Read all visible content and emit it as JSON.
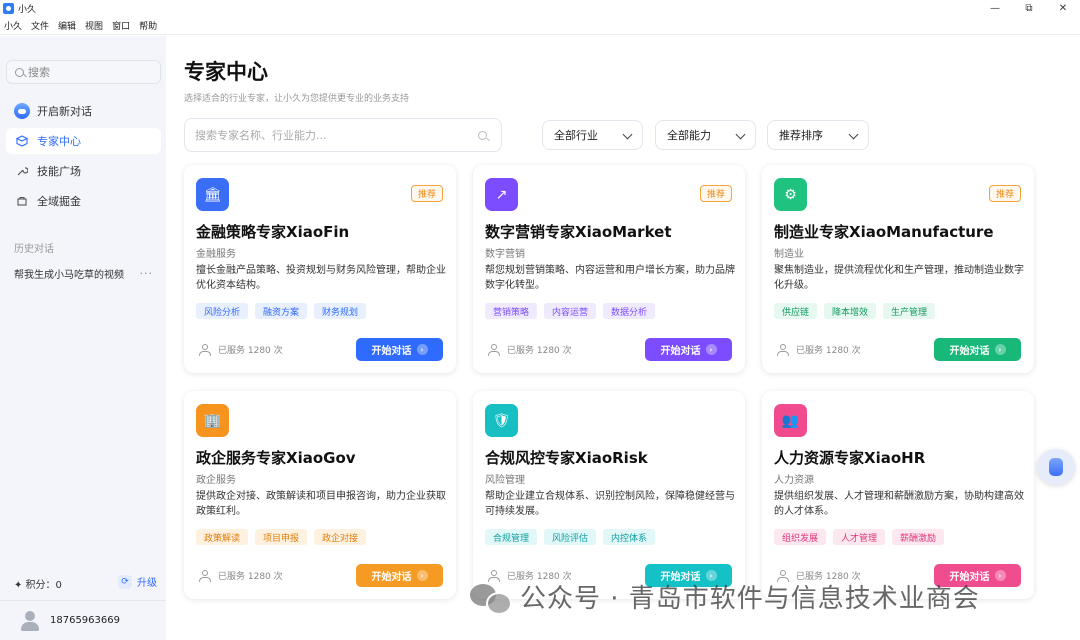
{
  "window": {
    "title": "小久",
    "controls": {
      "minimize": "—",
      "maximize": "⧉",
      "close": "✕"
    }
  },
  "menu": [
    "小久",
    "文件",
    "编辑",
    "视图",
    "窗口",
    "帮助"
  ],
  "sidebar": {
    "search_label": "搜索",
    "nav": [
      {
        "label": "开启新对话",
        "icon": "robot-icon"
      },
      {
        "label": "专家中心",
        "icon": "cube-icon"
      },
      {
        "label": "技能广场",
        "icon": "wrench-icon"
      },
      {
        "label": "全域掘金",
        "icon": "box-icon"
      }
    ],
    "history_title": "历史对话",
    "history": [
      {
        "label": "帮我生成小马吃草的视频",
        "more": "···"
      }
    ],
    "points_label": "✦ 积分：0",
    "upgrade_label": "升级",
    "user_phone": "18765963669"
  },
  "main": {
    "title": "专家中心",
    "subtitle": "选择适合的行业专家，让小久为您提供更专业的业务支持",
    "search_placeholder": "搜索专家名称、行业能力...",
    "filters": [
      "全部行业",
      "全部能力",
      "推荐排序"
    ]
  },
  "cards": [
    {
      "title": "金融策略专家XiaoFin",
      "category": "金融服务",
      "desc": "擅长金融产品策略、投资规划与财务风险管理，帮助企业优化资本结构。",
      "tags": [
        "风险分析",
        "融资方案",
        "财务规划"
      ],
      "recommended": "推荐",
      "served": "已服务 1280 次",
      "button": "开始对话",
      "icon": "bank-icon",
      "icon_glyph": "🏛",
      "color": "#2f6bff",
      "icon_bg": "#3a6ef6",
      "tag_bg": "#e8efff",
      "tag_fg": "#2f6bff"
    },
    {
      "title": "数字营销专家XiaoMarket",
      "category": "数字营销",
      "desc": "帮您规划营销策略、内容运营和用户增长方案，助力品牌数字化转型。",
      "tags": [
        "营销策略",
        "内容运营",
        "数据分析"
      ],
      "recommended": "推荐",
      "served": "已服务 1280 次",
      "button": "开始对话",
      "icon": "trend-icon",
      "icon_glyph": "↗",
      "color": "#7b4dff",
      "icon_bg": "#7b4dff",
      "tag_bg": "#f0eaff",
      "tag_fg": "#7b4dff"
    },
    {
      "title": "制造业专家XiaoManufacture",
      "category": "制造业",
      "desc": "聚焦制造业，提供流程优化和生产管理，推动制造业数字化升级。",
      "tags": [
        "供应链",
        "降本增效",
        "生产管理"
      ],
      "recommended": "推荐",
      "served": "已服务 1280 次",
      "button": "开始对话",
      "icon": "factory-icon",
      "icon_glyph": "⚙",
      "color": "#18b878",
      "icon_bg": "#20c27f",
      "tag_bg": "#e6f8ef",
      "tag_fg": "#129a62"
    },
    {
      "title": "政企服务专家XiaoGov",
      "category": "政企服务",
      "desc": "提供政企对接、政策解读和项目申报咨询，助力企业获取政策红利。",
      "tags": [
        "政策解读",
        "项目申报",
        "政企对接"
      ],
      "recommended": "",
      "served": "已服务 1280 次",
      "button": "开始对话",
      "icon": "government-icon",
      "icon_glyph": "🏢",
      "color": "#f59a23",
      "icon_bg": "#f7941d",
      "tag_bg": "#fff1e0",
      "tag_fg": "#e07f0c"
    },
    {
      "title": "合规风控专家XiaoRisk",
      "category": "风险管理",
      "desc": "帮助企业建立合规体系、识别控制风险，保障稳健经营与可持续发展。",
      "tags": [
        "合规管理",
        "风险评估",
        "内控体系"
      ],
      "recommended": "",
      "served": "已服务 1280 次",
      "button": "开始对话",
      "icon": "shield-icon",
      "icon_glyph": "🛡",
      "color": "#14c1c6",
      "icon_bg": "#17bfc3",
      "tag_bg": "#e2f7f7",
      "tag_fg": "#0e9ea2"
    },
    {
      "title": "人力资源专家XiaoHR",
      "category": "人力资源",
      "desc": "提供组织发展、人才管理和薪酬激励方案，协助构建高效的人才体系。",
      "tags": [
        "组织发展",
        "人才管理",
        "薪酬激励"
      ],
      "recommended": "",
      "served": "已服务 1280 次",
      "button": "开始对话",
      "icon": "people-icon",
      "icon_glyph": "👥",
      "color": "#f04d8f",
      "icon_bg": "#ef4b8e",
      "tag_bg": "#fde8f0",
      "tag_fg": "#e0377c"
    }
  ],
  "watermark": "公众号 · 青岛市软件与信息技术业商会"
}
